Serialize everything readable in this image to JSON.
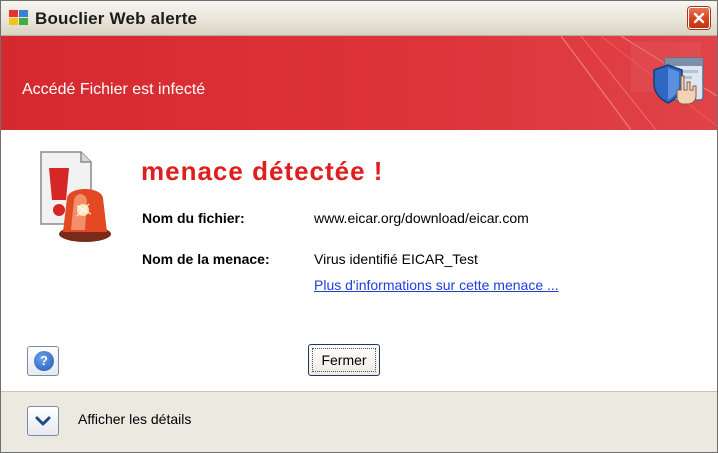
{
  "window": {
    "title": "Bouclier Web alerte",
    "close_icon": "close-icon"
  },
  "banner": {
    "title": "Accédé Fichier est infecté",
    "icon": "shield-hand-icon"
  },
  "alert": {
    "icon": "alarm-beacon-icon",
    "heading": "menace détectée !",
    "file_label": "Nom du fichier:",
    "file_value": "www.eicar.org/download/eicar.com",
    "threat_label": "Nom de la menace:",
    "threat_value": "Virus identifié EICAR_Test",
    "more_info_link": "Plus d'informations sur cette menace ..."
  },
  "buttons": {
    "help_icon": "help-icon",
    "help_glyph": "?",
    "close_label": "Fermer"
  },
  "footer": {
    "expand_icon": "chevron-down-icon",
    "details_label": "Afficher les détails"
  },
  "colors": {
    "banner_red": "#d92f34",
    "heading_red": "#e01e1e",
    "link_blue": "#1f3fd8"
  }
}
